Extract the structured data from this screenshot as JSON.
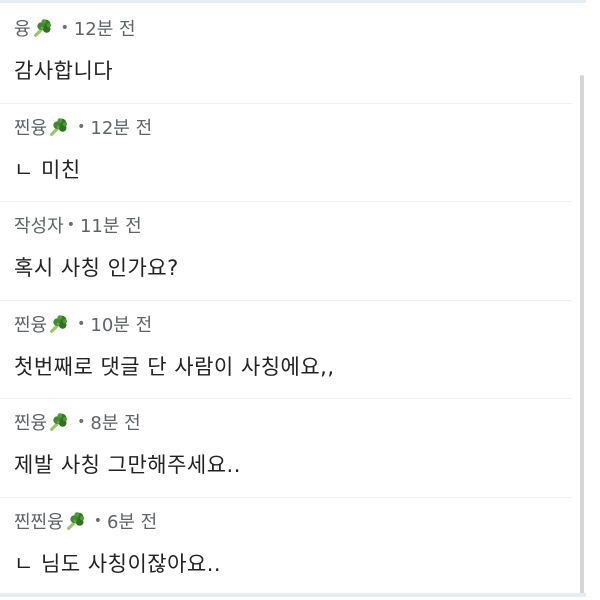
{
  "comments": [
    {
      "author": "융",
      "author_icon": "broccoli-icon",
      "separator": "•",
      "time": "12분 전",
      "text": "감사합니다"
    },
    {
      "author": "찐융",
      "author_icon": "broccoli-icon",
      "separator": "•",
      "time": "12분 전",
      "text": "ㄴ 미친"
    },
    {
      "author": "작성자",
      "author_icon": null,
      "separator": "•",
      "time": "11분 전",
      "text": "혹시 사칭 인가요?"
    },
    {
      "author": "찐융",
      "author_icon": "broccoli-icon",
      "separator": "•",
      "time": "10분 전",
      "text": "첫번째로 댓글 단 사람이 사칭에요,,"
    },
    {
      "author": "찐융",
      "author_icon": "broccoli-icon",
      "separator": "•",
      "time": "8분 전",
      "text": "제발 사칭 그만해주세요.."
    },
    {
      "author": "찐찐융",
      "author_icon": "broccoli-icon",
      "separator": "•",
      "time": "6분 전",
      "text": "ㄴ 님도 사칭이잖아요.."
    }
  ],
  "colors": {
    "meta_text": "#5f6368",
    "body_text": "#222222",
    "divider": "#eef1f5",
    "rule": "#e6ecf4",
    "scrollbar": "#d5d5d5",
    "broccoli_green": "#3f8a2c"
  }
}
